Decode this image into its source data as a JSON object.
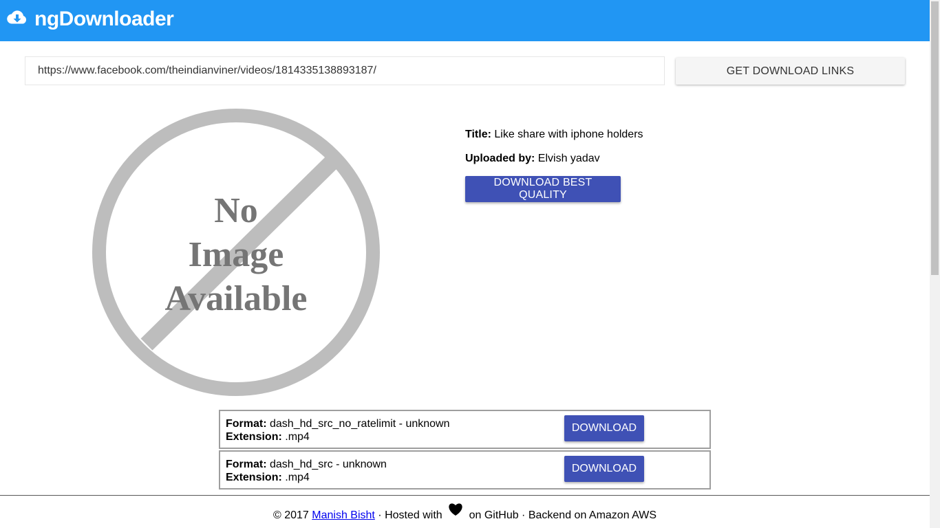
{
  "app": {
    "title": "ngDownloader",
    "logo_icon": "cloud-download-icon",
    "brand_color": "#2196f3"
  },
  "search": {
    "url_value": "https://www.facebook.com/theindianviner/videos/1814335138893187/",
    "get_links_label": "GET DOWNLOAD LINKS"
  },
  "thumbnail": {
    "text_line1": "No",
    "text_line2": "Image",
    "text_line3": "Available"
  },
  "video": {
    "title_label": "Title:",
    "title_value": " Like share with iphone holders",
    "uploader_label": "Uploaded by:",
    "uploader_value": " Elvish yadav",
    "best_quality_label": "DOWNLOAD BEST QUALITY"
  },
  "formats": [
    {
      "format_label": "Format:",
      "format_value": " dash_hd_src_no_ratelimit - unknown",
      "extension_label": "Extension:",
      "extension_value": " .mp4",
      "download_label": "DOWNLOAD"
    },
    {
      "format_label": "Format:",
      "format_value": " dash_hd_src - unknown",
      "extension_label": "Extension:",
      "extension_value": " .mp4",
      "download_label": "DOWNLOAD"
    }
  ],
  "footer": {
    "prefix": "© 2017 ",
    "author_link": "Manish Bisht",
    "hosted_text": " · Hosted with ",
    "heart_icon": "heart-icon",
    "suffix": " on GitHub · Backend on Amazon AWS"
  },
  "colors": {
    "primary_button": "#3f51b5",
    "secondary_button": "#f5f5f5"
  }
}
